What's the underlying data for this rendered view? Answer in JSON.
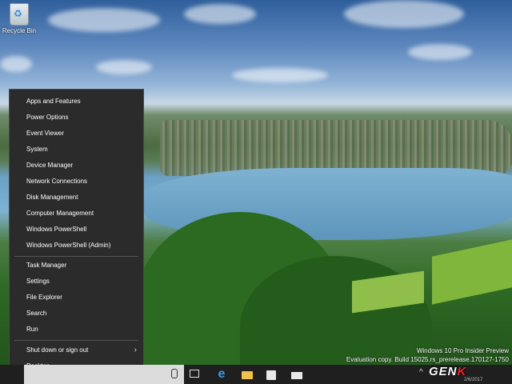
{
  "desktop": {
    "recycle_bin_label": "Recycle Bin"
  },
  "power_user_menu": {
    "group1": [
      {
        "label": "Apps and Features"
      },
      {
        "label": "Power Options"
      },
      {
        "label": "Event Viewer"
      },
      {
        "label": "System"
      },
      {
        "label": "Device Manager"
      },
      {
        "label": "Network Connections"
      },
      {
        "label": "Disk Management"
      },
      {
        "label": "Computer Management"
      },
      {
        "label": "Windows PowerShell"
      },
      {
        "label": "Windows PowerShell (Admin)"
      }
    ],
    "group2": [
      {
        "label": "Task Manager"
      },
      {
        "label": "Settings"
      },
      {
        "label": "File Explorer"
      },
      {
        "label": "Search"
      },
      {
        "label": "Run"
      }
    ],
    "group3": [
      {
        "label": "Shut down or sign out",
        "submenu_icon": "chevron-right-icon"
      },
      {
        "label": "Desktop"
      }
    ]
  },
  "watermark": {
    "line1": "Windows 10 Pro Insider Preview",
    "line2": "Evaluation copy. Build 15025.rs_prerelease.170127-1750"
  },
  "brand": {
    "text_main": "GEN",
    "text_accent": "K",
    "accent_color": "#e8232a"
  },
  "taskbar": {
    "icons": [
      "search-box",
      "microphone-icon",
      "task-view-icon",
      "edge-icon",
      "file-explorer-icon",
      "store-icon",
      "mail-icon",
      "tray-expand-icon"
    ],
    "date": "2/6/2017"
  }
}
